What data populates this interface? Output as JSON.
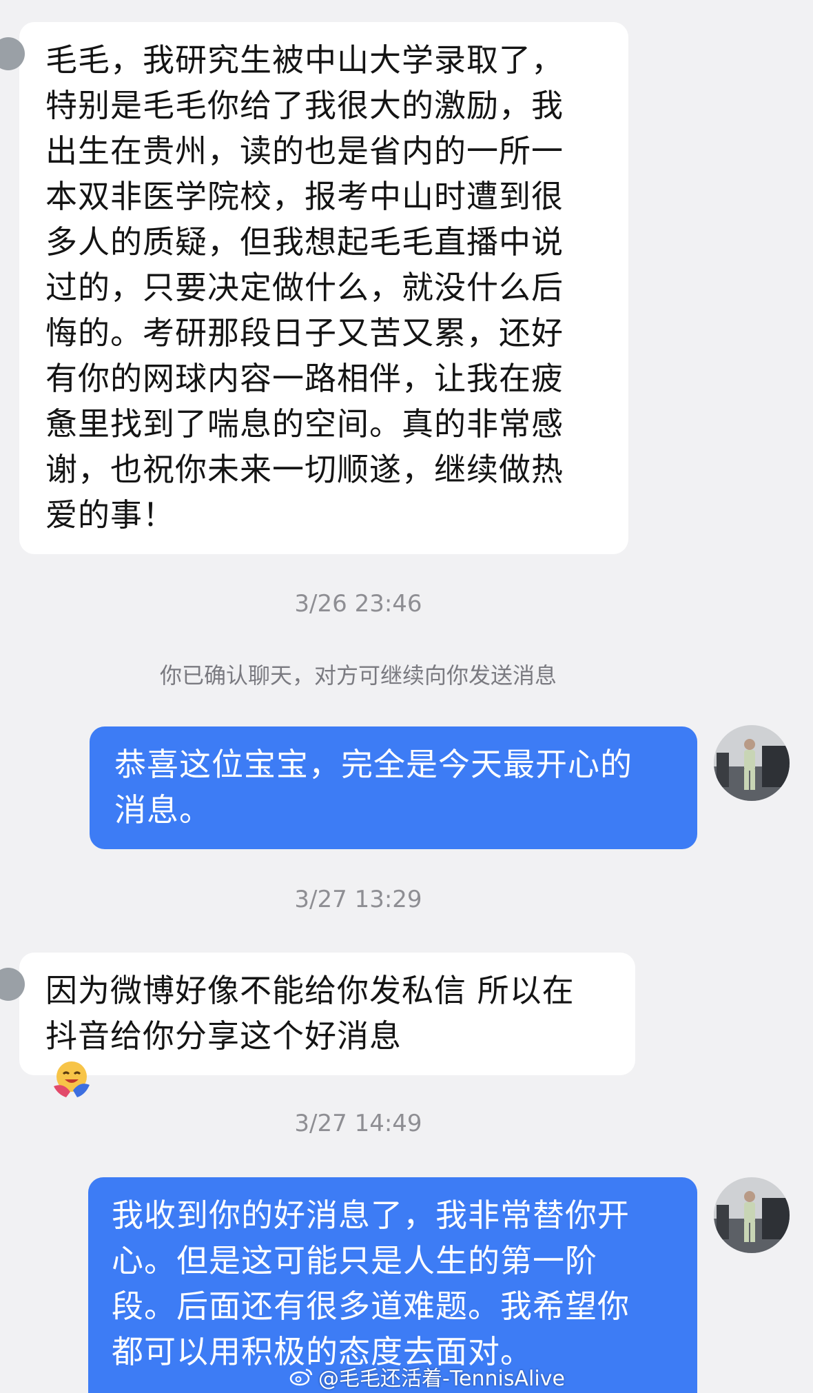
{
  "messages": [
    {
      "sender": "peer",
      "text": "毛毛，我研究生被中山大学录取了，\n特别是毛毛你给了我很大的激励，我\n出生在贵州，读的也是省内的一所一\n本双非医学院校，报考中山时遭到很\n多人的质疑，但我想起毛毛直播中说\n过的，只要决定做什么，就没什么后\n悔的。考研那段日子又苦又累，还好\n有你的网球内容一路相伴，让我在疲\n惫里找到了喘息的空间。真的非常感\n谢，也祝你未来一切顺遂，继续做热\n爱的事！"
    },
    {
      "sender": "self",
      "text": "恭喜这位宝宝，完全是今天最开心的\n消息。"
    },
    {
      "sender": "peer",
      "text": "因为微博好像不能给你发私信 所以在\n抖音给你分享这个好消息"
    },
    {
      "sender": "self",
      "text": "我收到你的好消息了，我非常替你开\n心。但是这可能只是人生的第一阶\n段。后面还有很多道难题。我希望你\n都可以用积极的态度去面对。"
    }
  ],
  "timestamps": [
    "3/26 23:46",
    "3/27 13:29",
    "3/27 14:49"
  ],
  "system_notice": "你已确认聊天，对方可继续向你发送消息",
  "emoji": "hugging-face-emoji",
  "watermark": "@毛毛还活着-TennisAlive",
  "colors": {
    "background": "#f1f1f3",
    "incoming_bubble": "#ffffff",
    "outgoing_bubble": "#3d7cf5",
    "timestamp_text": "#8e8e93"
  }
}
